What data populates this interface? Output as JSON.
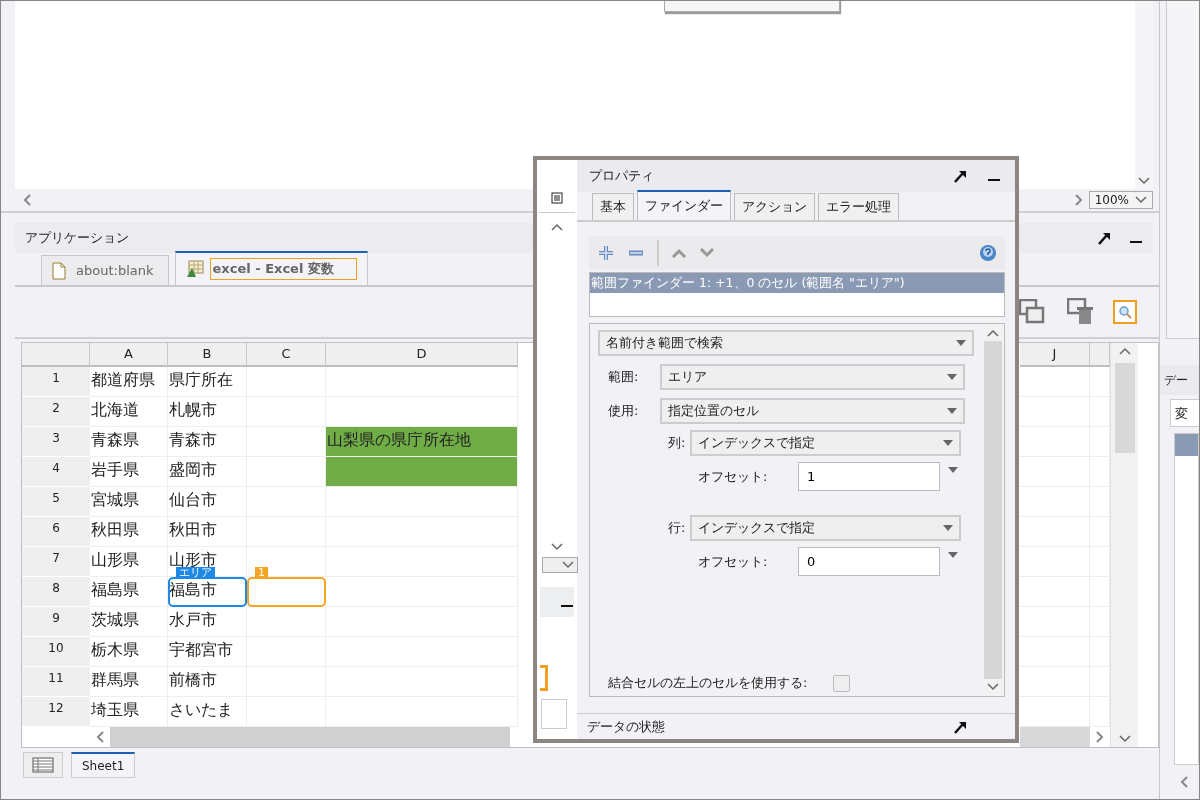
{
  "preview": {
    "zoom": "100%"
  },
  "application_panel": {
    "title": "アプリケーション",
    "tabs": [
      {
        "label": "about:blank",
        "kind": "page",
        "selected": false
      },
      {
        "label": "excel - Excel 変数",
        "kind": "sheet",
        "selected": true
      }
    ],
    "toolbar": [
      {
        "kind": "copy",
        "highlighted": false
      },
      {
        "kind": "delete",
        "highlighted": false
      },
      {
        "kind": "search",
        "highlighted": true
      }
    ]
  },
  "spreadsheet": {
    "columns": [
      "A",
      "B",
      "C",
      "D",
      "J"
    ],
    "rows": [
      {
        "number": "1",
        "cells": [
          {
            "text": "都道府県"
          },
          {
            "text": "県庁所在"
          }
        ]
      },
      {
        "number": "2",
        "cells": [
          {
            "text": "北海道"
          },
          {
            "text": "札幌市"
          }
        ]
      },
      {
        "number": "3",
        "cells": [
          {
            "text": "青森県"
          },
          {
            "text": "青森市"
          },
          {},
          {
            "text": "山梨県の県庁所在地",
            "filled": true
          }
        ]
      },
      {
        "number": "4",
        "cells": [
          {
            "text": "岩手県"
          },
          {
            "text": "盛岡市"
          },
          {},
          {
            "filled": true
          }
        ]
      },
      {
        "number": "5",
        "cells": [
          {
            "text": "宮城県"
          },
          {
            "text": "仙台市"
          }
        ]
      },
      {
        "number": "6",
        "cells": [
          {
            "text": "秋田県"
          },
          {
            "text": "秋田市"
          }
        ]
      },
      {
        "number": "7",
        "cells": [
          {
            "text": "山形県"
          },
          {
            "text": "山形市"
          }
        ]
      },
      {
        "number": "8",
        "cells": [
          {
            "text": "福島県"
          },
          {
            "text": "福島市",
            "marker": {
              "kind": "range",
              "label": "エリア"
            }
          },
          {
            "marker": {
              "kind": "target",
              "label": "1"
            }
          }
        ]
      },
      {
        "number": "9",
        "cells": [
          {
            "text": "茨城県"
          },
          {
            "text": "水戸市"
          }
        ]
      },
      {
        "number": "10",
        "cells": [
          {
            "text": "栃木県"
          },
          {
            "text": "宇都宮市"
          }
        ]
      },
      {
        "number": "11",
        "cells": [
          {
            "text": "群馬県"
          },
          {
            "text": "前橋市"
          }
        ]
      },
      {
        "number": "12",
        "cells": [
          {
            "text": "埼玉県"
          },
          {
            "text": "さいたま"
          }
        ]
      }
    ],
    "sheet_tabs": [
      {
        "label": "Sheet1",
        "selected": true
      }
    ]
  },
  "properties": {
    "title": "プロパティ",
    "tabs": [
      {
        "label": "基本",
        "selected": false
      },
      {
        "label": "ファインダー",
        "selected": true
      },
      {
        "label": "アクション",
        "selected": false
      },
      {
        "label": "エラー処理",
        "selected": false
      }
    ],
    "finders": [
      {
        "text": "範囲ファインダー 1: +1、0 のセル (範囲名 \"エリア\")",
        "selected": true
      }
    ],
    "search_mode": "名前付き範囲で検索",
    "fields": [
      {
        "kind": "select",
        "label": "範囲:",
        "value": "エリア"
      },
      {
        "kind": "select",
        "label": "使用:",
        "value": "指定位置のセル"
      },
      {
        "kind": "subselect",
        "label": "列:",
        "value": "インデックスで指定"
      },
      {
        "kind": "offset",
        "label": "オフセット:",
        "value": "1"
      },
      {
        "kind": "subselect",
        "label": "行:",
        "value": "インデックスで指定"
      },
      {
        "kind": "offset",
        "label": "オフセット:",
        "value": "0"
      }
    ],
    "merged_cell_option": {
      "label": "結合セルの左上のセルを使用する:",
      "checked": false
    },
    "next_section": "データの状態"
  },
  "side_panel": {
    "header": "デー",
    "tab": "変"
  }
}
